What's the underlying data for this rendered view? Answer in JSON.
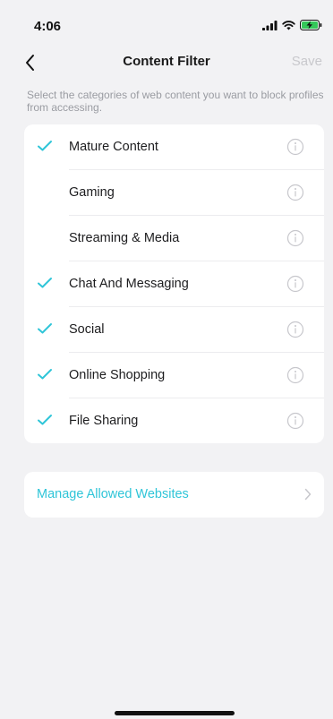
{
  "status_bar": {
    "time": "4:06",
    "signal_icon": "cellular-signal-icon",
    "wifi_icon": "wifi-icon",
    "battery_icon": "battery-charging-icon"
  },
  "nav": {
    "back_icon": "chevron-left-icon",
    "title": "Content Filter",
    "save_label": "Save"
  },
  "description": "Select the categories of web content you want to block profiles from accessing.",
  "categories": [
    {
      "label": "Mature Content",
      "checked": true
    },
    {
      "label": "Gaming",
      "checked": false
    },
    {
      "label": "Streaming & Media",
      "checked": false
    },
    {
      "label": "Chat And Messaging",
      "checked": true
    },
    {
      "label": "Social",
      "checked": true
    },
    {
      "label": "Online Shopping",
      "checked": true
    },
    {
      "label": "File Sharing",
      "checked": true
    }
  ],
  "manage": {
    "label": "Manage Allowed Websites",
    "icon": "chevron-right-icon"
  },
  "colors": {
    "accent": "#2fc5d8",
    "background": "#f2f2f4",
    "card": "#ffffff",
    "disabled_text": "#c8c8cc",
    "secondary_text": "#9a9ca2",
    "info_icon": "#c7c7cc",
    "battery_green": "#34c759"
  }
}
